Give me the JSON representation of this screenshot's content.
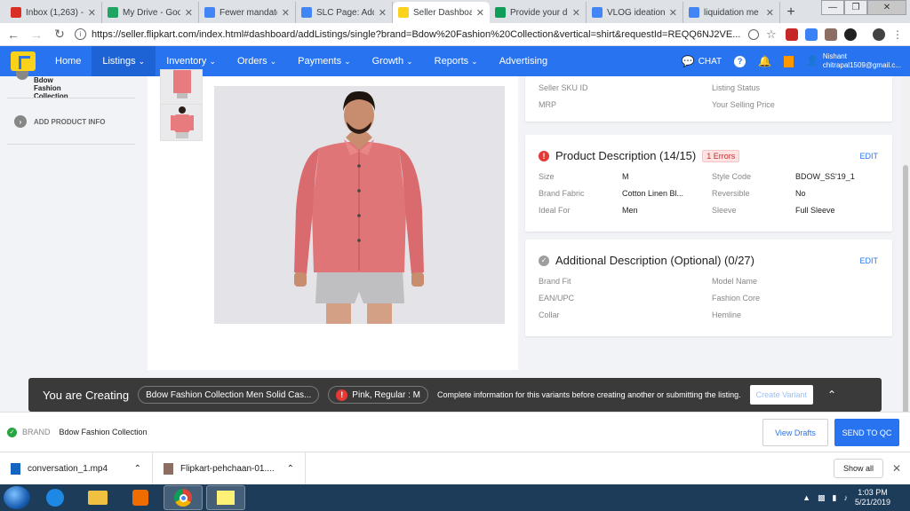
{
  "browser": {
    "tabs": [
      {
        "title": "Inbox (1,263) -",
        "fav": "gmail-icon",
        "color": "#d93025"
      },
      {
        "title": "My Drive - Goo",
        "fav": "drive-icon",
        "color": "#1fa463"
      },
      {
        "title": "Fewer mandato",
        "fav": "docs-icon",
        "color": "#4285f4"
      },
      {
        "title": "SLC Page: Add",
        "fav": "docs-icon",
        "color": "#4285f4"
      },
      {
        "title": "Seller Dashboa",
        "fav": "flipkart-icon",
        "color": "#fbd21b",
        "active": true
      },
      {
        "title": "Provide your de",
        "fav": "sheets-icon",
        "color": "#0f9d58"
      },
      {
        "title": "VLOG ideation",
        "fav": "docs-icon",
        "color": "#4285f4"
      },
      {
        "title": "liquidation me",
        "fav": "google-icon",
        "color": "#4285f4"
      }
    ],
    "url": "https://seller.flipkart.com/index.html#dashboard/addListings/single?brand=Bdow%20Fashion%20Collection&vertical=shirt&requestId=REQQ6NJ2VE..."
  },
  "nav": {
    "items": [
      "Home",
      "Listings",
      "Inventory",
      "Orders",
      "Payments",
      "Growth",
      "Reports",
      "Advertising"
    ],
    "active": "Listings",
    "chat": "CHAT",
    "user_name": "Nishant",
    "user_email": "chitrapal1509@gmail.c..."
  },
  "sidebar": {
    "brand": "Bdow Fashion Collection",
    "add_info": "ADD PRODUCT INFO"
  },
  "top_card": {
    "seller_sku": "Seller SKU ID",
    "listing_status": "Listing Status",
    "mrp": "MRP",
    "selling_price": "Your Selling Price"
  },
  "product_description": {
    "title": "Product Description (14/15)",
    "errors": "1 Errors",
    "edit": "EDIT",
    "rows": [
      {
        "l1": "Size",
        "v1": "M",
        "l2": "Style Code",
        "v2": "BDOW_SS'19_1"
      },
      {
        "l1": "Brand Fabric",
        "v1": "Cotton Linen Bl...",
        "l2": "Reversible",
        "v2": "No"
      },
      {
        "l1": "Ideal For",
        "v1": "Men",
        "l2": "Sleeve",
        "v2": "Full Sleeve"
      }
    ]
  },
  "additional_description": {
    "title": "Additional Description (Optional) (0/27)",
    "edit": "EDIT",
    "fields": [
      [
        "Brand Fit",
        "Model Name"
      ],
      [
        "EAN/UPC",
        "Fashion Core"
      ],
      [
        "Collar",
        "Hemline"
      ]
    ]
  },
  "creating_bar": {
    "label": "You are Creating",
    "product": "Bdow Fashion Collection Men Solid Cas...",
    "variant": "Pink, Regular : M",
    "message": "Complete information for this variants before creating another or submitting the listing.",
    "create_variant": "Create Variant"
  },
  "bottom_bar": {
    "brand_label": "BRAND",
    "brand_value": "Bdow Fashion Collection",
    "view_drafts": "View Drafts",
    "send_qc": "SEND TO QC"
  },
  "downloads": {
    "items": [
      "conversation_1.mp4",
      "Flipkart-pehchaan-01...."
    ],
    "show_all": "Show all"
  },
  "taskbar": {
    "time": "1:03 PM",
    "date": "5/21/2019"
  }
}
